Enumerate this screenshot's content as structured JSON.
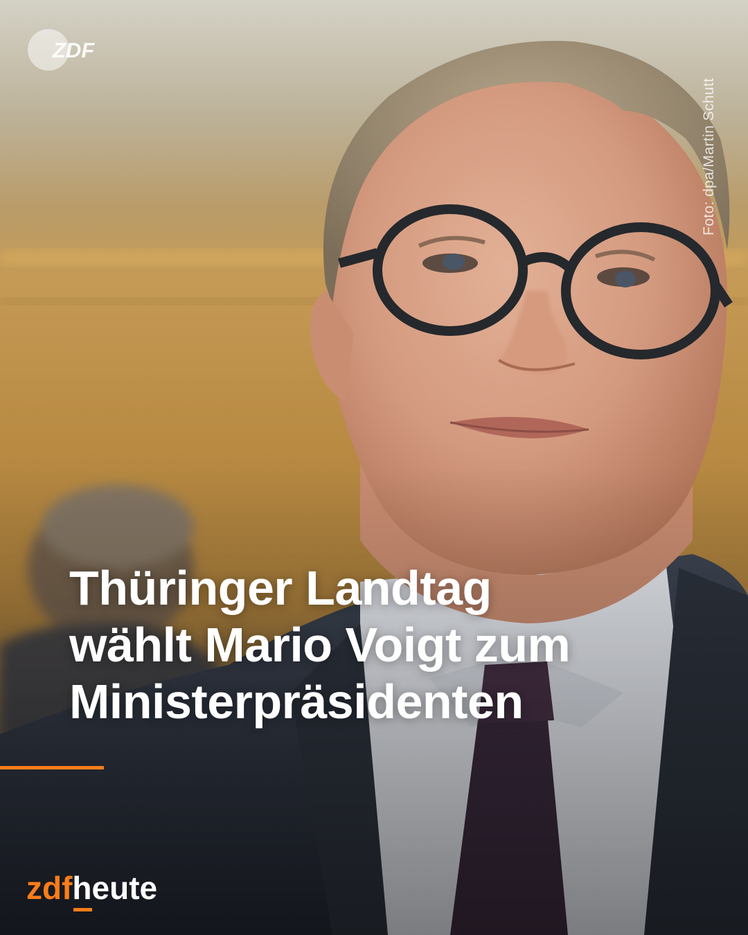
{
  "watermark": {
    "text": "ZDF"
  },
  "photo_credit": "Foto: dpa/Martin Schutt",
  "headline": {
    "lines": [
      "Thüringer Landtag",
      "wählt Mario Voigt zum",
      "Ministerpräsidenten"
    ]
  },
  "brand": {
    "prefix": "zdf",
    "suffix": "heute"
  },
  "colors": {
    "accent": "#fa7d19",
    "text": "#ffffff"
  }
}
